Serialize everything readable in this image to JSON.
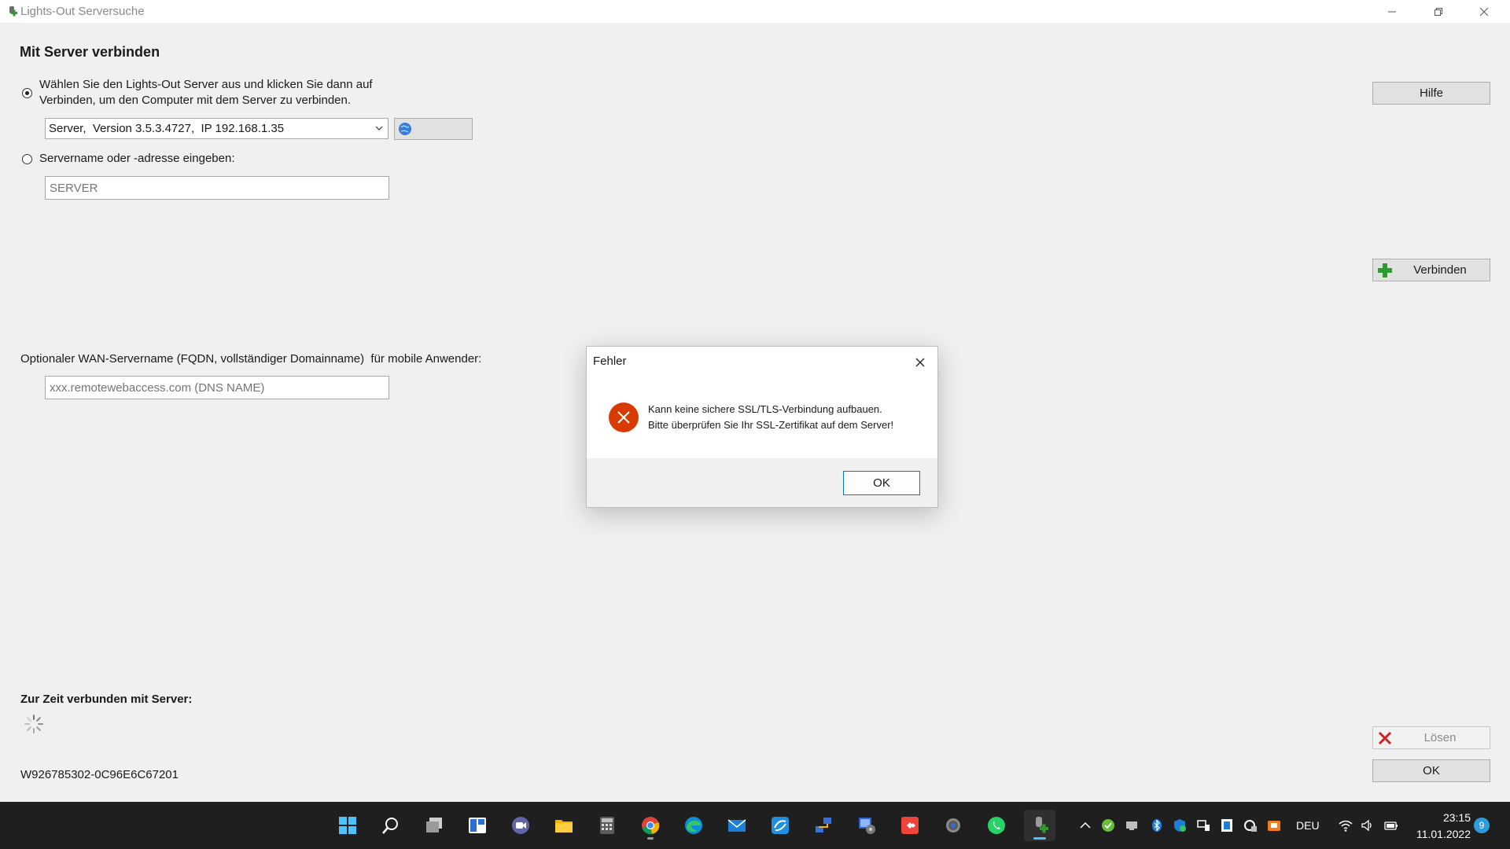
{
  "window": {
    "title": "Lights-Out Serversuche"
  },
  "connect": {
    "heading": "Mit Server verbinden",
    "option_select_label": "Wählen Sie den Lights-Out Server aus und klicken Sie dann auf Verbinden, um den Computer mit dem Server zu verbinden.",
    "server_combo_value": "Server,  Version 3.5.3.4727,  IP 192.168.1.35",
    "option_manual_label": "Servername oder -adresse eingeben:",
    "server_name_placeholder": "SERVER",
    "wan_label": "Optionaler WAN-Servername (FQDN, vollständiger Domainname)  für mobile Anwender:",
    "wan_placeholder": "xxx.remotewebaccess.com (DNS NAME)"
  },
  "buttons": {
    "help": "Hilfe",
    "connect": "Verbinden",
    "disconnect": "Lösen",
    "ok": "OK"
  },
  "status": {
    "heading": "Zur Zeit verbunden mit Server:",
    "device_id": "W926785302-0C96E6C67201"
  },
  "dialog": {
    "title": "Fehler",
    "message_line1": "Kann keine sichere SSL/TLS-Verbindung aufbauen.",
    "message_line2": "Bitte überprüfen Sie Ihr SSL-Zertifikat auf dem Server!",
    "ok": "OK"
  },
  "taskbar": {
    "language": "DEU",
    "time": "23:15",
    "date": "11.01.2022",
    "notification_count": "9"
  },
  "colors": {
    "accent": "#0078d4",
    "error": "#d83b01",
    "connect_green": "#2e9c2e",
    "disconnect_red": "#d42020"
  }
}
